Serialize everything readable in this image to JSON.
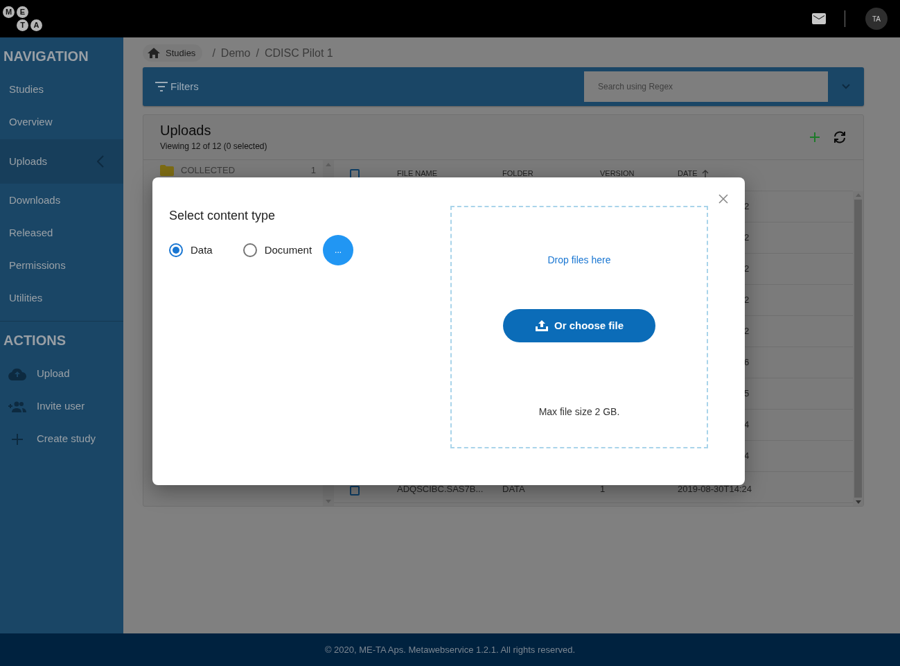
{
  "logo": [
    "M",
    "E",
    "T",
    "A"
  ],
  "header": {
    "avatar": "TA"
  },
  "sidebar": {
    "sections": [
      {
        "title": "NAVIGATION",
        "items": [
          {
            "label": "Studies",
            "selected": false,
            "expandable": false
          },
          {
            "label": "Overview",
            "selected": false,
            "expandable": false
          },
          {
            "label": "Uploads",
            "selected": true,
            "expandable": true
          },
          {
            "label": "Downloads",
            "selected": false,
            "expandable": false
          },
          {
            "label": "Released",
            "selected": false,
            "expandable": false
          },
          {
            "label": "Permissions",
            "selected": false,
            "expandable": false
          },
          {
            "label": "Utilities",
            "selected": false,
            "expandable": false
          }
        ]
      },
      {
        "title": "ACTIONS",
        "items": [
          {
            "label": "Upload",
            "kind": "upload"
          },
          {
            "label": "Invite user",
            "kind": "invite"
          },
          {
            "label": "Create study",
            "kind": "create"
          }
        ]
      }
    ]
  },
  "breadcrumb": [
    {
      "label": "Studies",
      "kind": "home"
    },
    {
      "label": "Demo",
      "kind": "plain",
      "separator": "/"
    },
    {
      "label": "CDISC Pilot 1",
      "kind": "plain",
      "separator": "/"
    }
  ],
  "filters": {
    "label": "Filters",
    "placeholder": "Search using Regex"
  },
  "uploads": {
    "title": "Uploads",
    "subtitle": "Viewing 12 of 12 (0 selected)",
    "folders": [
      {
        "name": "COLLECTED",
        "count": "1"
      }
    ],
    "select_all": {
      "checked": false
    },
    "columns": [
      {
        "label": "FILE NAME",
        "sorted": false
      },
      {
        "label": "FOLDER",
        "sorted": false
      },
      {
        "label": "VERSION",
        "sorted": false
      },
      {
        "label": "DATE",
        "sorted": true
      }
    ],
    "rows": [
      {
        "kind": "covered",
        "date": "2"
      },
      {
        "kind": "covered",
        "date": "2"
      },
      {
        "kind": "covered",
        "date": "2"
      },
      {
        "kind": "covered",
        "date": "2"
      },
      {
        "kind": "covered",
        "date": "2"
      },
      {
        "kind": "covered",
        "date": "6"
      },
      {
        "kind": "covered",
        "date": "5"
      },
      {
        "kind": "covered",
        "date": "4"
      },
      {
        "kind": "covered",
        "date": "4"
      },
      {
        "kind": "full",
        "checked": false,
        "file": "ADQSCIBC.SAS7B...",
        "folder": "DATA",
        "version": "1",
        "date": "2019-08-30T14:24"
      }
    ]
  },
  "modal": {
    "title": "Select content type",
    "options": [
      {
        "label": "Data",
        "selected": true
      },
      {
        "label": "Document",
        "selected": false
      }
    ],
    "more_button": "...",
    "drop_text": "Drop files here",
    "choose_button": "Or choose file",
    "max_size": "Max file size 2 GB."
  },
  "footer": "© 2020, ME-TA Aps. Metawebservice 1.2.1. All rights reserved."
}
